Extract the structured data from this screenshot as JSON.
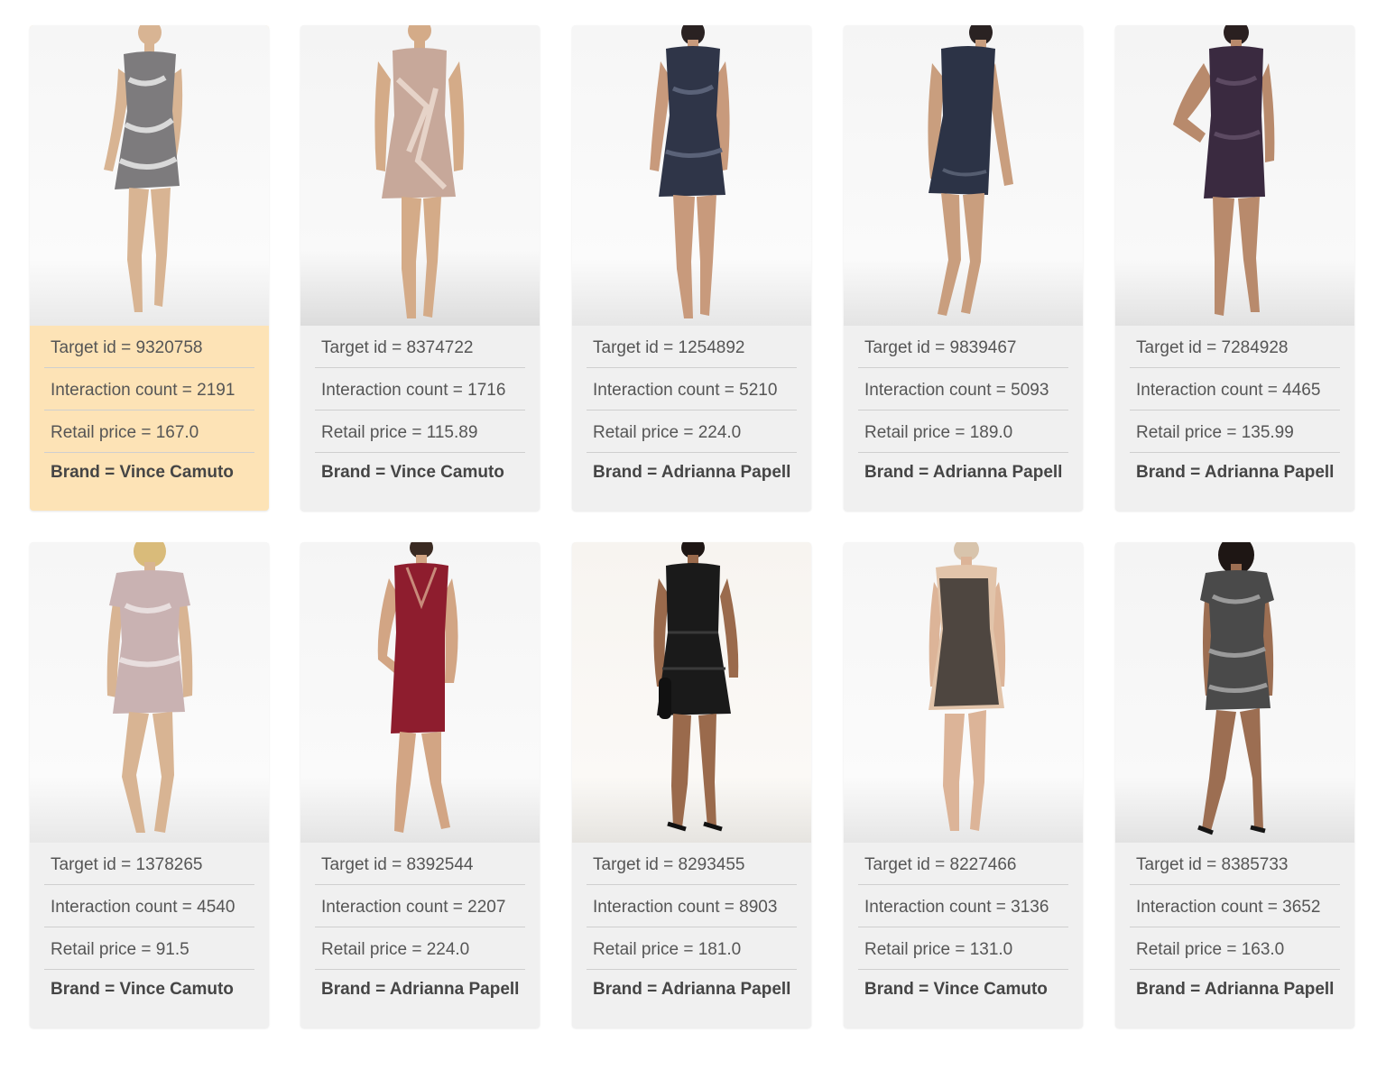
{
  "selected_index": 0,
  "colors": {
    "selected_background": "#fde3b6",
    "card_background": "#f0f0f0",
    "divider": "#cfcfcf"
  },
  "products": [
    {
      "target_id": "Target id = 9320758",
      "interaction_count": "Interaction count = 2191",
      "retail_price": "Retail price = 167.0",
      "brand": "Brand = Vince Camuto",
      "image": "dress-photo-silver-sequin-sleeveless"
    },
    {
      "target_id": "Target id = 8374722",
      "interaction_count": "Interaction count = 1716",
      "retail_price": "Retail price = 115.89",
      "brand": "Brand = Vince Camuto",
      "image": "dress-photo-champagne-halter"
    },
    {
      "target_id": "Target id = 1254892",
      "interaction_count": "Interaction count = 5210",
      "retail_price": "Retail price = 224.0",
      "brand": "Brand = Adrianna Papell",
      "image": "dress-photo-navy-beaded-keyhole"
    },
    {
      "target_id": "Target id = 9839467",
      "interaction_count": "Interaction count = 5093",
      "retail_price": "Retail price = 189.0",
      "brand": "Brand = Adrianna Papell",
      "image": "dress-photo-navy-sleeveless"
    },
    {
      "target_id": "Target id = 7284928",
      "interaction_count": "Interaction count = 4465",
      "retail_price": "Retail price = 135.99",
      "brand": "Brand = Adrianna Papell",
      "image": "dress-photo-plum-beaded"
    },
    {
      "target_id": "Target id = 1378265",
      "interaction_count": "Interaction count = 4540",
      "retail_price": "Retail price = 91.5",
      "brand": "Brand = Vince Camuto",
      "image": "dress-photo-blush-sequin-short-sleeve"
    },
    {
      "target_id": "Target id = 8392544",
      "interaction_count": "Interaction count = 2207",
      "retail_price": "Retail price = 224.0",
      "brand": "Brand = Adrianna Papell",
      "image": "dress-photo-burgundy-v-neck"
    },
    {
      "target_id": "Target id = 8293455",
      "interaction_count": "Interaction count = 8903",
      "retail_price": "Retail price = 181.0",
      "brand": "Brand = Adrianna Papell",
      "image": "dress-photo-black-lace-halter"
    },
    {
      "target_id": "Target id = 8227466",
      "interaction_count": "Interaction count = 3136",
      "retail_price": "Retail price = 131.0",
      "brand": "Brand = Vince Camuto",
      "image": "dress-photo-black-nude-lace"
    },
    {
      "target_id": "Target id = 8385733",
      "interaction_count": "Interaction count = 3652",
      "retail_price": "Retail price = 163.0",
      "brand": "Brand = Adrianna Papell",
      "image": "dress-photo-black-silver-cap-sleeve"
    }
  ]
}
